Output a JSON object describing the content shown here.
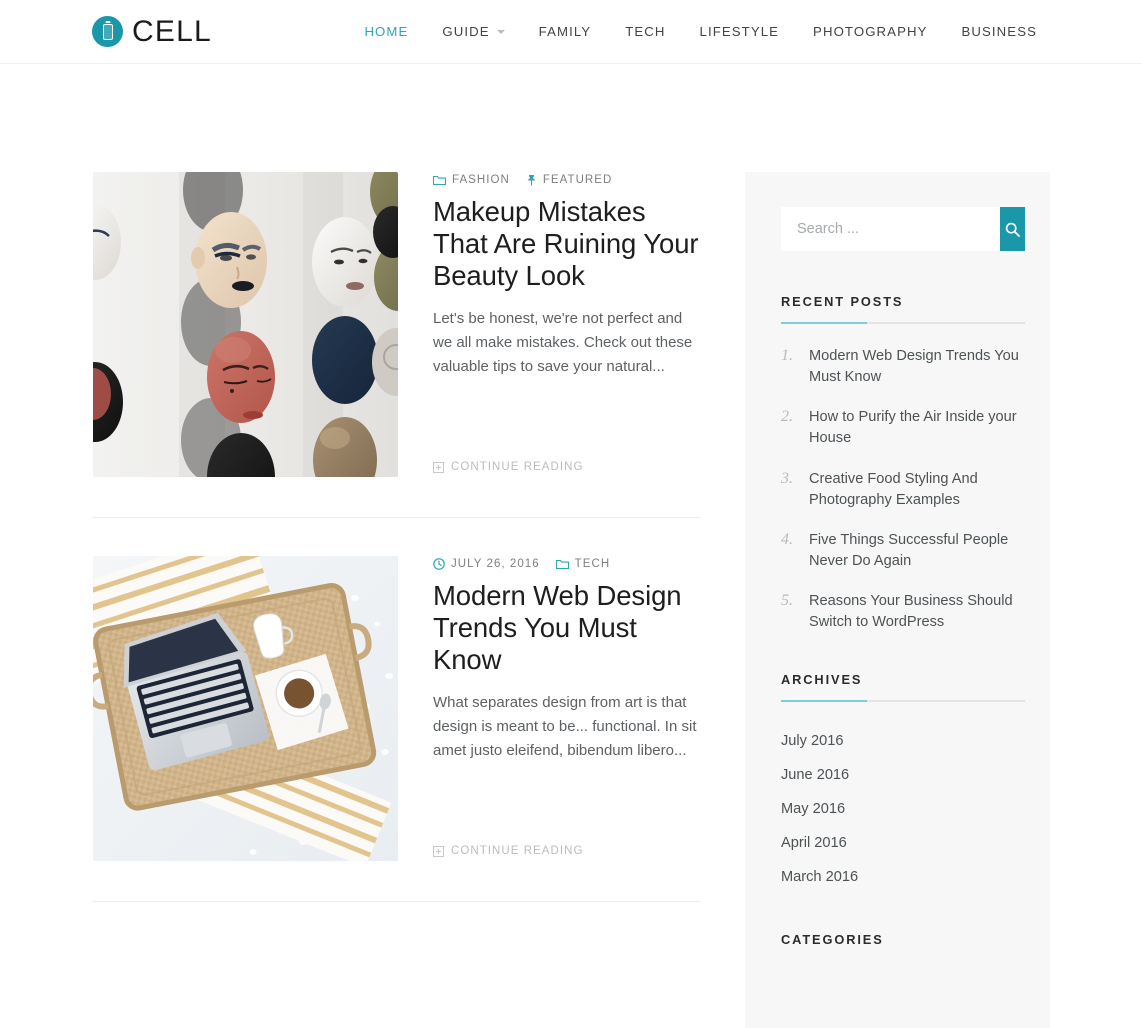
{
  "header": {
    "brand_name": "CELL",
    "brand_icon": "battery-cell-icon",
    "nav": [
      {
        "label": "HOME",
        "active": true,
        "has_dropdown": false
      },
      {
        "label": "GUIDE",
        "active": false,
        "has_dropdown": true
      },
      {
        "label": "FAMILY",
        "active": false,
        "has_dropdown": false
      },
      {
        "label": "TECH",
        "active": false,
        "has_dropdown": false
      },
      {
        "label": "LIFESTYLE",
        "active": false,
        "has_dropdown": false
      },
      {
        "label": "PHOTOGRAPHY",
        "active": false,
        "has_dropdown": false
      },
      {
        "label": "BUSINESS",
        "active": false,
        "has_dropdown": false
      }
    ]
  },
  "posts": [
    {
      "meta": [
        {
          "icon": "folder-icon",
          "label": "FASHION"
        },
        {
          "icon": "pin-icon",
          "label": "FEATURED"
        }
      ],
      "title": "Makeup Mistakes That Are Ruining Your Beauty Look",
      "excerpt": "Let's be honest, we're not perfect and we all make mistakes. Check out these valuable tips to save your natural...",
      "continue_label": "CONTINUE READING",
      "image_alt": "mannequin-heads-on-white-wall"
    },
    {
      "meta": [
        {
          "icon": "clock-icon",
          "label": "JULY 26, 2016"
        },
        {
          "icon": "folder-icon",
          "label": "TECH"
        }
      ],
      "title": "Modern Web Design Trends You Must Know",
      "excerpt": "What separates design from art is that design is meant to be... functional. In sit amet justo eleifend, bibendum libero...",
      "continue_label": "CONTINUE READING",
      "image_alt": "laptop-on-wicker-tray-with-coffee"
    }
  ],
  "sidebar": {
    "search": {
      "placeholder": "Search ...",
      "value": "",
      "button_icon": "search-icon"
    },
    "recent_posts": {
      "title": "RECENT POSTS",
      "items": [
        {
          "num": "1.",
          "text": "Modern Web Design Trends You Must Know"
        },
        {
          "num": "2.",
          "text": "How to Purify the Air Inside your House"
        },
        {
          "num": "3.",
          "text": "Creative Food Styling And Photography Examples"
        },
        {
          "num": "4.",
          "text": "Five Things Successful People Never Do Again"
        },
        {
          "num": "5.",
          "text": "Reasons Your Business Should Switch to WordPress"
        }
      ]
    },
    "archives": {
      "title": "ARCHIVES",
      "items": [
        "July 2016",
        "June 2016",
        "May 2016",
        "April 2016",
        "March 2016"
      ]
    },
    "categories": {
      "title": "CATEGORIES"
    }
  },
  "colors": {
    "accent": "#1a97a8",
    "accent_light": "#2fa5b8",
    "rule_accent": "#7fcdd8",
    "sidebar_bg": "#f7f7f7",
    "text": "#3b3b3b",
    "muted": "#b9bcbe"
  }
}
